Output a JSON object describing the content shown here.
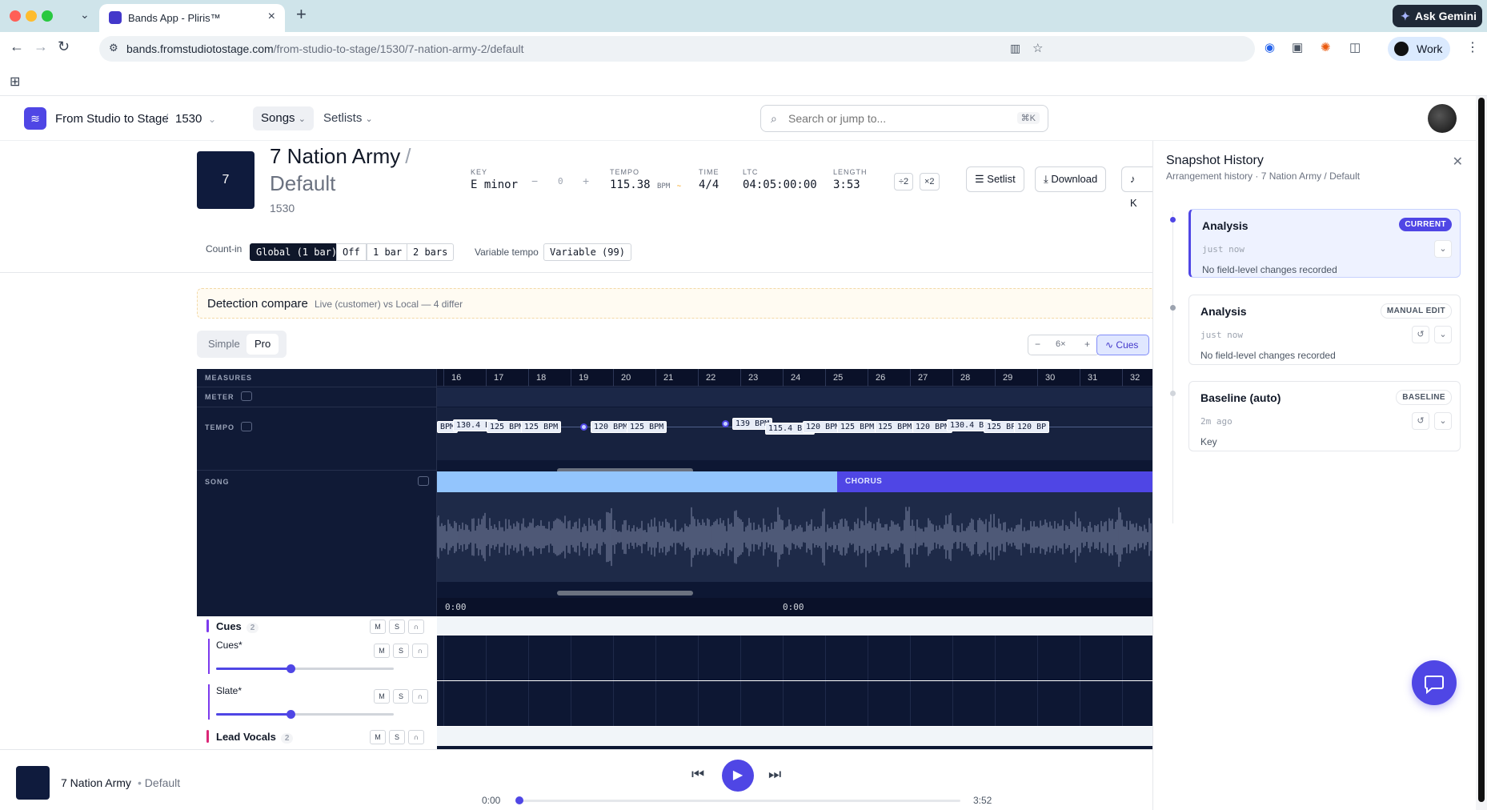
{
  "browser": {
    "tab_title": "Bands App - Pliris™",
    "url_host": "bands.fromstudiotostage.com",
    "url_path": "/from-studio-to-stage/1530/7-nation-army-2/default",
    "gemini_label": "Ask Gemini",
    "profile_label": "Work"
  },
  "header": {
    "org": "From Studio to Stage",
    "separator": "/",
    "band_id": "1530",
    "nav": {
      "songs": "Songs",
      "setlists": "Setlists"
    },
    "search": {
      "placeholder": "Search or jump to...",
      "shortcut": "⌘K"
    }
  },
  "song": {
    "art_number": "7",
    "title": "7 Nation Army",
    "slash": "/",
    "arrangement": "Default",
    "number": "1530",
    "key": {
      "label": "KEY",
      "value": "E minor",
      "transpose": "0"
    },
    "tempo": {
      "label": "TEMPO",
      "value": "115.38",
      "unit": "BPM",
      "approx": "~"
    },
    "time": {
      "label": "TIME",
      "value": "4/4"
    },
    "ltc": {
      "label": "LTC",
      "value": "04:05:00:00"
    },
    "length": {
      "label": "LENGTH",
      "value": "3:53"
    },
    "chips": [
      "÷2",
      "×2"
    ],
    "buttons": {
      "setlist": "Setlist",
      "download": "Download",
      "more": "K"
    }
  },
  "count_in": {
    "label": "Count-in",
    "options": [
      "Global (1 bar)",
      "Off",
      "1 bar",
      "2 bars"
    ],
    "selected": "Global (1 bar)",
    "variable_tempo_label": "Variable tempo",
    "variable_tempo_value": "Variable (99)"
  },
  "detection": {
    "title": "Detection compare",
    "subtitle": "Live (customer) vs Local — 4 differ"
  },
  "mode": {
    "simple": "Simple",
    "pro": "Pro",
    "selected": "Pro"
  },
  "zoom": {
    "minus": "−",
    "level": "6×",
    "plus": "+"
  },
  "cues_button": "Cues",
  "timeline": {
    "row_labels": {
      "measures": "MEASURES",
      "meter": "METER",
      "tempo": "TEMPO",
      "song": "SONG"
    },
    "measures": [
      "16",
      "17",
      "18",
      "19",
      "20",
      "21",
      "22",
      "23",
      "24",
      "25",
      "26",
      "27",
      "28",
      "29",
      "30",
      "31",
      "32"
    ],
    "tempo_chips": [
      "BPM",
      "130.4 BI",
      "125 BPM",
      "125 BPM",
      "120 BPM",
      "125 BPM",
      "139 BPM",
      "115.4 BPM",
      "120 BPM",
      "125 BPM",
      "125 BPM",
      "120 BPM",
      "130.4 BI",
      "125 BPM",
      "120 BP"
    ],
    "sections": [
      "",
      "CHORUS"
    ],
    "time_labels": [
      "0:00",
      "0:00"
    ]
  },
  "tracks": [
    {
      "name": "Cues",
      "count": "2",
      "type": "group",
      "color": "#7c3aed"
    },
    {
      "name": "Cues*",
      "type": "track",
      "color": "#7c3aed",
      "volume": 0.42
    },
    {
      "name": "Slate*",
      "type": "track",
      "color": "#7c3aed",
      "volume": 0.42
    },
    {
      "name": "Lead Vocals",
      "count": "2",
      "type": "group",
      "color": "#db2777"
    }
  ],
  "track_buttons": {
    "mute": "M",
    "solo": "S"
  },
  "snapshot": {
    "title": "Snapshot History",
    "subtitle": "Arrangement history · 7 Nation Army / Default",
    "entries": [
      {
        "title": "Analysis",
        "badge": "CURRENT",
        "when": "just now",
        "desc": "No field-level changes recorded"
      },
      {
        "title": "Analysis",
        "badge": "MANUAL EDIT",
        "when": "just now",
        "desc": "No field-level changes recorded"
      },
      {
        "title": "Baseline (auto)",
        "badge": "BASELINE",
        "when": "2m ago",
        "desc": "Key"
      }
    ]
  },
  "player": {
    "title": "7 Nation Army",
    "dot": "•",
    "arrangement": "Default",
    "time_current": "0:00",
    "time_total": "3:52",
    "progress": 0
  },
  "colors": {
    "accent": "#4f46e5",
    "navy": "#0d1733",
    "chorus": "#4f46e5",
    "verse": "#93c5fd"
  }
}
